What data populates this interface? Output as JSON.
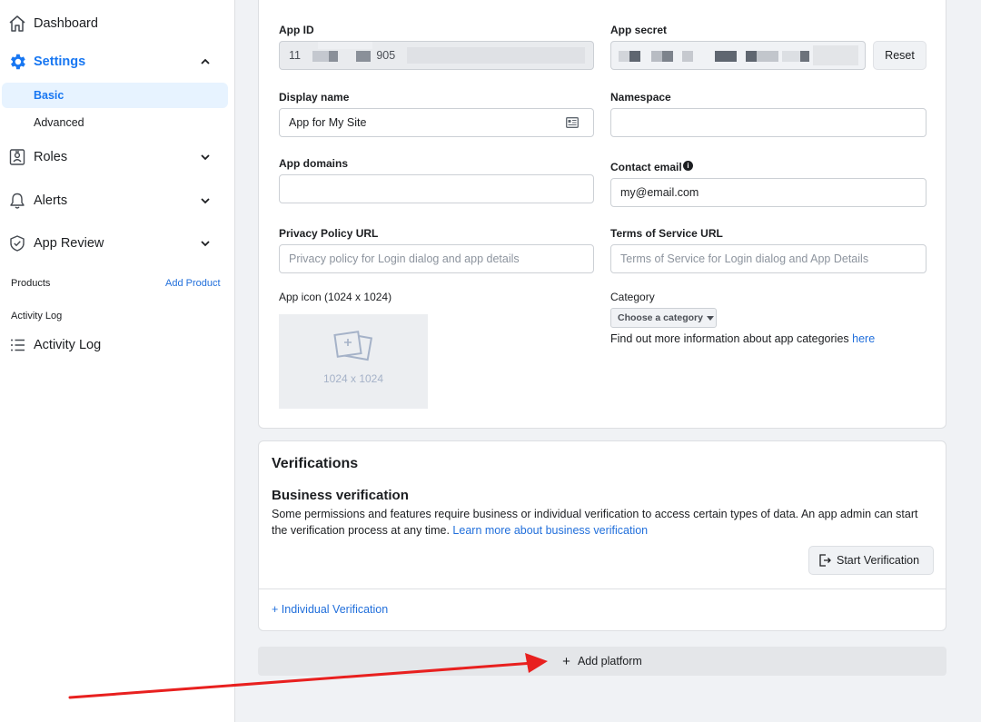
{
  "sidebar": {
    "dashboard": "Dashboard",
    "settings": "Settings",
    "basic": "Basic",
    "advanced": "Advanced",
    "roles": "Roles",
    "alerts": "Alerts",
    "app_review": "App Review",
    "products_label": "Products",
    "add_product": "Add Product",
    "activity_log_header": "Activity Log",
    "activity_log": "Activity Log"
  },
  "form": {
    "app_id_label": "App ID",
    "app_id_value": "11                        905",
    "app_secret_label": "App secret",
    "reset_label": "Reset",
    "display_name_label": "Display name",
    "display_name_value": "App for My Site",
    "namespace_label": "Namespace",
    "app_domains_label": "App domains",
    "contact_email_label": "Contact email",
    "contact_email_value": "my@email.com",
    "privacy_label": "Privacy Policy URL",
    "privacy_placeholder": "Privacy policy for Login dialog and app details",
    "tos_label": "Terms of Service URL",
    "tos_placeholder": "Terms of Service for Login dialog and App Details",
    "app_icon_label": "App icon (1024 x 1024)",
    "app_icon_dim": "1024 x 1024",
    "category_label": "Category",
    "category_button": "Choose a category",
    "category_info": "Find out more information about app categories",
    "category_link": "here"
  },
  "verifications": {
    "title": "Verifications",
    "subtitle": "Business verification",
    "text": "Some permissions and features require business or individual verification to access certain types of data. An app admin can start the verification process at any time.",
    "link": "Learn more about business verification",
    "start_button": "Start Verification",
    "individual": "+ Individual Verification"
  },
  "footer": {
    "add_platform": "Add platform"
  },
  "colors": {
    "accent": "#1877f2",
    "link": "#216fdb",
    "annotation_arrow": "#e8201f"
  }
}
